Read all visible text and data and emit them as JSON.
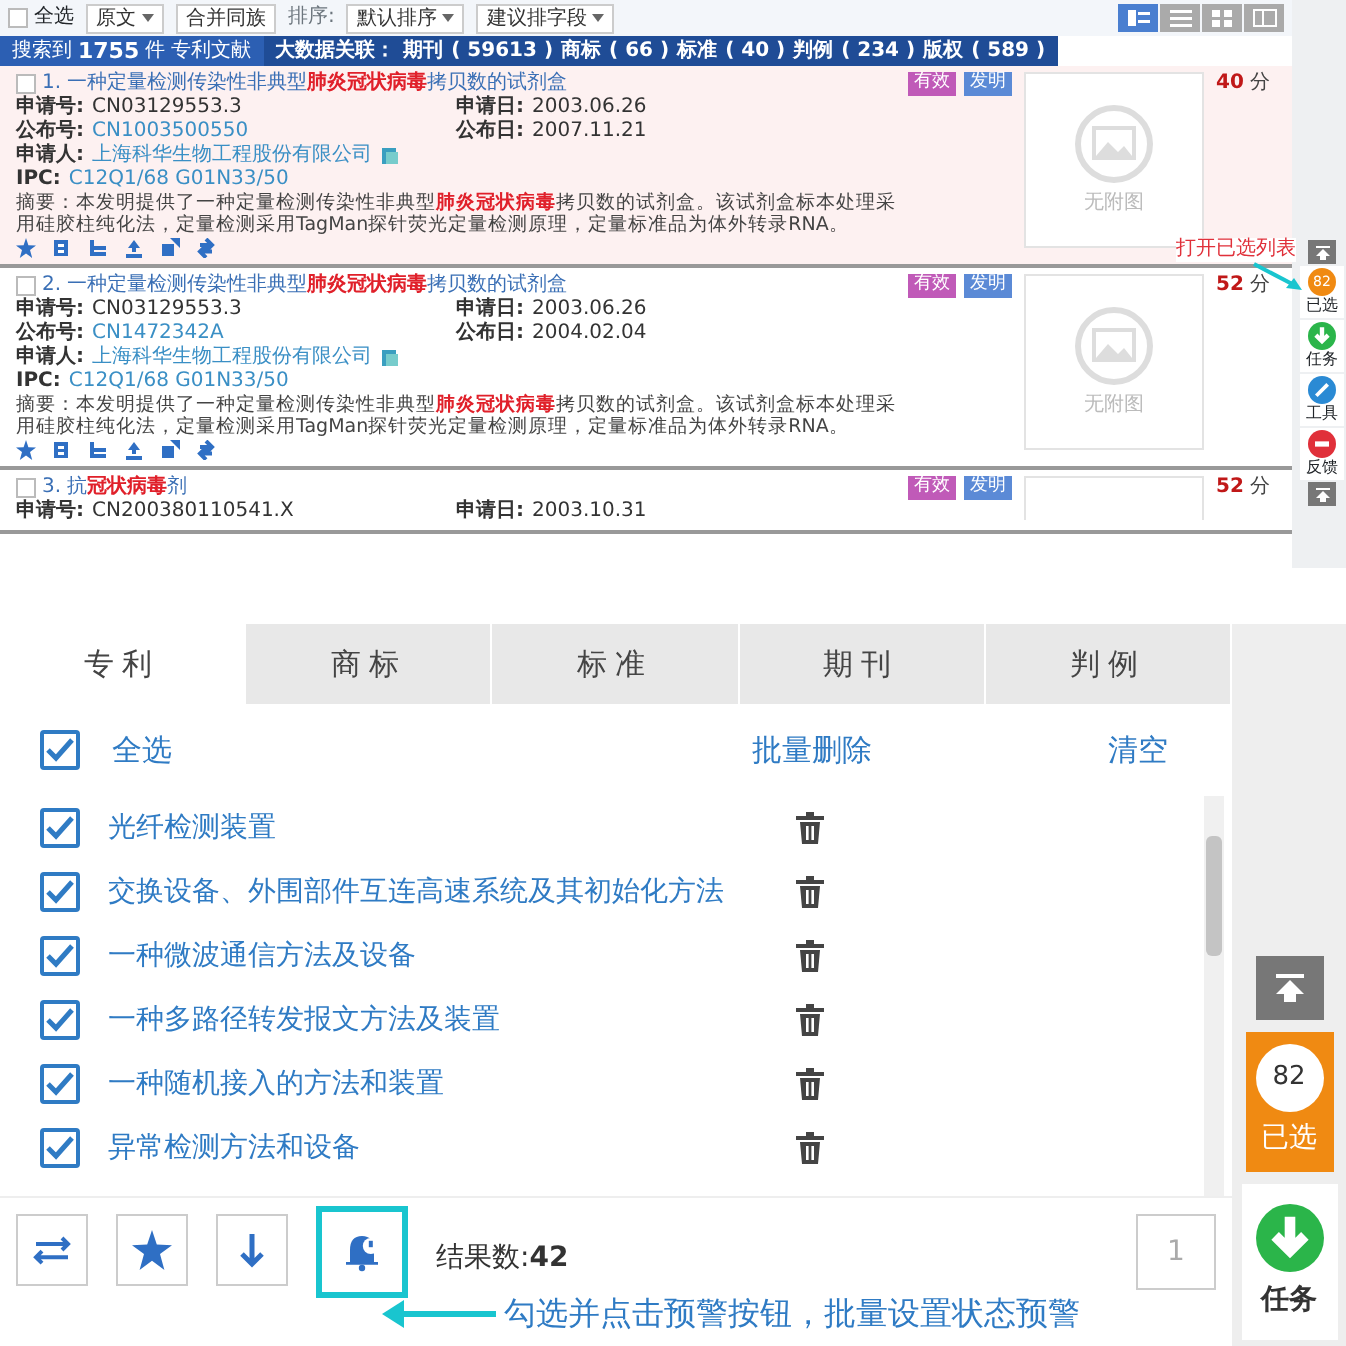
{
  "top_screenshot": {
    "toolbar": {
      "select_all": {
        "label": "全选",
        "checked": false
      },
      "view_dropdown": "原文",
      "merge_button": "合并同族",
      "sort_label": "排序:",
      "sort_dropdown": "默认排序",
      "field_dropdown": "建议排字段",
      "view_modes": [
        {
          "kind": "detail",
          "selected": true
        },
        {
          "kind": "list",
          "selected": false
        },
        {
          "kind": "grid",
          "selected": false
        },
        {
          "kind": "split",
          "selected": false
        }
      ]
    },
    "summary": {
      "label": "搜索到",
      "count": "1755",
      "unit": "件",
      "type": "专利文献"
    },
    "related": {
      "label": "大数据关联：",
      "items": [
        {
          "name": "期刊",
          "count": "( 59613 )"
        },
        {
          "name": "商标",
          "count": "( 66 )"
        },
        {
          "name": "标准",
          "count": "( 40 )"
        },
        {
          "name": "判例",
          "count": "( 234 )"
        },
        {
          "name": "版权",
          "count": "( 589 )"
        }
      ]
    },
    "results": [
      {
        "title": "1. 一种定量检测传染性非典型**肺炎冠状病毒**拷贝数的试剂盒",
        "checked": false,
        "highlighted": true,
        "status": "有效",
        "type": "发明",
        "score": "40",
        "score_unit": "分",
        "image_text": "无附图",
        "rows": [
          [
            {
              "label": "申请号:",
              "value": "CN03129553.3",
              "kind": "text"
            },
            {
              "label": "申请日:",
              "value": "2003.06.26",
              "kind": "text"
            }
          ],
          [
            {
              "label": "公布号:",
              "value": "CN1003500550",
              "kind": "link"
            },
            {
              "label": "公布日:",
              "value": "2007.11.21",
              "kind": "text"
            }
          ],
          [
            {
              "label": "申请人:",
              "value": "上海科华生物工程股份有限公司",
              "kind": "link_icon"
            }
          ],
          [
            {
              "label": "IPC:",
              "value": "C12Q1/68 G01N33/50",
              "kind": "link"
            }
          ]
        ],
        "abstract": "摘要：本发明提供了一种定量检测传染性非典型**肺炎冠状病毒**拷贝数的试剂盒。该试剂盒标本处理采用硅胶柱纯化法，定量检测采用TagMan探针荧光定量检测原理，定量标准品为体外转录RNA。"
      },
      {
        "title": "2. 一种定量检测传染性非典型**肺炎冠状病毒**拷贝数的试剂盒",
        "checked": false,
        "highlighted": false,
        "status": "有效",
        "type": "发明",
        "score": "52",
        "score_unit": "分",
        "image_text": "无附图",
        "rows": [
          [
            {
              "label": "申请号:",
              "value": "CN03129553.3",
              "kind": "text"
            },
            {
              "label": "申请日:",
              "value": "2003.06.26",
              "kind": "text"
            }
          ],
          [
            {
              "label": "公布号:",
              "value": "CN1472342A",
              "kind": "link"
            },
            {
              "label": "公布日:",
              "value": "2004.02.04",
              "kind": "text"
            }
          ],
          [
            {
              "label": "申请人:",
              "value": "上海科华生物工程股份有限公司",
              "kind": "link_icon"
            }
          ],
          [
            {
              "label": "IPC:",
              "value": "C12Q1/68 G01N33/50",
              "kind": "link"
            }
          ]
        ],
        "abstract": "摘要：本发明提供了一种定量检测传染性非典型**肺炎冠状病毒**拷贝数的试剂盒。该试剂盒标本处理采用硅胶柱纯化法，定量检测采用TagMan探针荧光定量检测原理，定量标准品为体外转录RNA。"
      },
      {
        "title": "3. 抗**冠状病毒**剂",
        "checked": false,
        "highlighted": false,
        "status": "有效",
        "type": "发明",
        "score": "52",
        "score_unit": "分",
        "rows": [
          [
            {
              "label": "申请号:",
              "value": "CN200380110541.X",
              "kind": "text"
            },
            {
              "label": "申请日:",
              "value": "2003.10.31",
              "kind": "text"
            }
          ]
        ]
      }
    ],
    "annotation": "打开已选列表",
    "sidebar": [
      {
        "kind": "top"
      },
      {
        "kind": "selected",
        "label": "已选",
        "badge": "82"
      },
      {
        "kind": "task",
        "label": "任务"
      },
      {
        "kind": "tool",
        "label": "工具"
      },
      {
        "kind": "feedback",
        "label": "反馈"
      },
      {
        "kind": "bottom"
      }
    ]
  },
  "selected_list": {
    "tabs": [
      {
        "label": "专利",
        "selected": true
      },
      {
        "label": "商标",
        "selected": false
      },
      {
        "label": "标准",
        "selected": false
      },
      {
        "label": "期刊",
        "selected": false
      },
      {
        "label": "判例",
        "selected": false
      }
    ],
    "select_all": {
      "label": "全选",
      "checked": true
    },
    "batch_delete": "批量删除",
    "clear": "清空",
    "items": [
      {
        "title": "光纤检测装置",
        "checked": true
      },
      {
        "title": "交换设备、外围部件互连高速系统及其初始化方法",
        "checked": true
      },
      {
        "title": "一种微波通信方法及设备",
        "checked": true
      },
      {
        "title": "一种多路径转发报文方法及装置",
        "checked": true
      },
      {
        "title": "一种随机接入的方法和装置",
        "checked": true
      },
      {
        "title": "异常检测方法和设备",
        "checked": true
      }
    ],
    "tools": [
      {
        "kind": "swap",
        "highlighted": false
      },
      {
        "kind": "star",
        "highlighted": false
      },
      {
        "kind": "download",
        "highlighted": false
      },
      {
        "kind": "alert",
        "highlighted": true
      }
    ],
    "result_count": "结果数:**42**",
    "page": "1",
    "annotation": "勾选并点击预警按钮，批量设置状态预警",
    "sidebar": [
      {
        "kind": "top"
      },
      {
        "kind": "selected",
        "label": "已选",
        "badge": "82"
      },
      {
        "kind": "task",
        "label": "任务"
      }
    ]
  }
}
